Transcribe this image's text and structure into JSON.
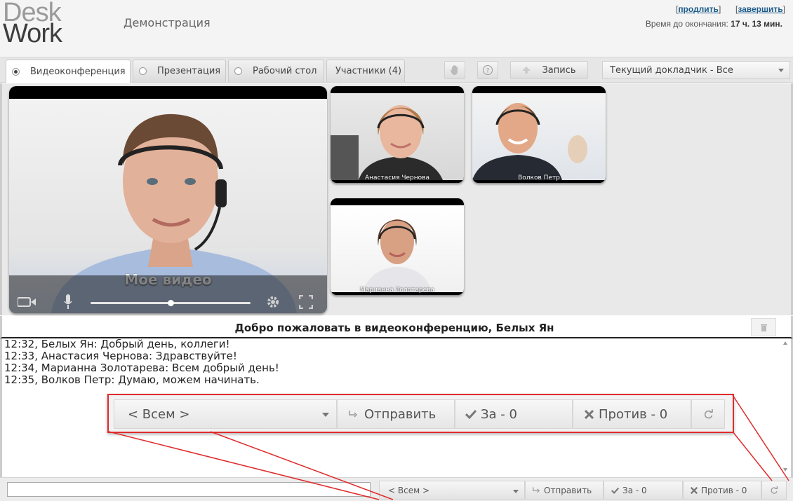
{
  "header": {
    "logo_line1": "Desk",
    "logo_line2": "Work",
    "session_title": "Демонстрация",
    "link_extend": "продлить",
    "link_finish": "завершить",
    "timer_label": "Время до окончания:",
    "timer_value": "17 ч. 13 мин."
  },
  "toolbar": {
    "tabs": [
      {
        "label": "Видеоконференция",
        "selected": true
      },
      {
        "label": "Презентация",
        "selected": false
      },
      {
        "label": "Рабочий стол",
        "selected": false
      }
    ],
    "participants_tab": "Участники (4)",
    "hand_icon": "hand-icon",
    "help_icon": "help-icon",
    "record_label": "Запись",
    "speaker_select": "Текущий докладчик - Все"
  },
  "video": {
    "main_label": "Мое видео",
    "volume_level": 0.5,
    "participants": [
      {
        "name": "Анастасия Чернова"
      },
      {
        "name": "Волков Петр"
      },
      {
        "name": "Марианна Золотарева"
      }
    ]
  },
  "chat": {
    "title": "Добро пожаловать в видеоконференцию, Белых Ян",
    "messages": [
      "12:32, Белых Ян: Добрый день, коллеги!",
      "12:33, Анастасия Чернова: Здравствуйте!",
      "12:34, Марианна Золотарева: Всем добрый день!",
      "12:35, Волков Петр: Думаю, можем начинать."
    ]
  },
  "controls": {
    "recipient": "< Всем >",
    "send": "Отправить",
    "vote_for": "За - 0",
    "vote_against": "Против - 0",
    "input_value": ""
  },
  "colors": {
    "callout": "#e02b2b",
    "link": "#1d5c8c"
  }
}
